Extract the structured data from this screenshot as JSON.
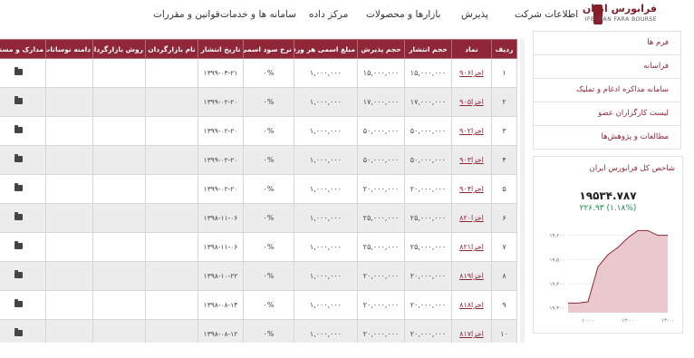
{
  "logo": {
    "name_fa": "فرابورس ایران",
    "name_en": "IFB IRAN FARA BOURSE"
  },
  "nav": {
    "company_info": "اطلاعات شرکت",
    "admission": "پذیرش",
    "markets": "بازارها و محصولات",
    "data_center": "مرکز داده",
    "systems": "سامانه ها و خدمات",
    "laws": "قوانین و مقررات"
  },
  "table": {
    "headers": [
      "ردیف",
      "نماد",
      "حجم انتشار",
      "حجم پذیرش",
      "مبلغ اسمی هر ورقه",
      "نرخ سود اسمی",
      "تاریخ انتشار",
      "نام بازارگردان",
      "روش بازارگردانی",
      "دامنه نوسانات",
      "مدارک و مستندات"
    ],
    "rows": [
      {
        "n": "۱",
        "sym": "اخزا۹۰۶",
        "vol": "۱۵,۰۰۰,۰۰۰",
        "acc": "۱۵,۰۰۰,۰۰۰",
        "nom": "۱,۰۰۰,۰۰۰",
        "rate": "۰%",
        "date": "۱۳۹۹-۰۳-۲۱"
      },
      {
        "n": "۲",
        "sym": "اخزا۹۰۵",
        "vol": "۱۷,۰۰۰,۰۰۰",
        "acc": "۱۷,۰۰۰,۰۰۰",
        "nom": "۱,۰۰۰,۰۰۰",
        "rate": "۰%",
        "date": "۱۳۹۹-۰۲-۲۰"
      },
      {
        "n": "۳",
        "sym": "اخزا۹۰۲",
        "vol": "۵۰,۰۰۰,۰۰۰",
        "acc": "۵۰,۰۰۰,۰۰۰",
        "nom": "۱,۰۰۰,۰۰۰",
        "rate": "۰%",
        "date": "۱۳۹۹-۰۲-۲۰"
      },
      {
        "n": "۴",
        "sym": "اخزا۹۰۳",
        "vol": "۵۰,۰۰۰,۰۰۰",
        "acc": "۵۰,۰۰۰,۰۰۰",
        "nom": "۱,۰۰۰,۰۰۰",
        "rate": "۰%",
        "date": "۱۳۹۹-۰۲-۲۰"
      },
      {
        "n": "۵",
        "sym": "اخزا۹۰۴",
        "vol": "۲۰,۰۰۰,۰۰۰",
        "acc": "۲۰,۰۰۰,۰۰۰",
        "nom": "۱,۰۰۰,۰۰۰",
        "rate": "۰%",
        "date": "۱۳۹۹-۰۲-۲۰"
      },
      {
        "n": "۶",
        "sym": "اخزا۸۲۰",
        "vol": "۲۵,۰۰۰,۰۰۰",
        "acc": "۲۵,۰۰۰,۰۰۰",
        "nom": "۱,۰۰۰,۰۰۰",
        "rate": "۰%",
        "date": "۱۳۹۸-۱۱-۰۶"
      },
      {
        "n": "۷",
        "sym": "اخزا۸۲۱",
        "vol": "۲۵,۰۰۰,۰۰۰",
        "acc": "۲۵,۰۰۰,۰۰۰",
        "nom": "۱,۰۰۰,۰۰۰",
        "rate": "۰%",
        "date": "۱۳۹۸-۱۱-۰۶"
      },
      {
        "n": "۸",
        "sym": "اخزا۸۱۹",
        "vol": "۲۰,۰۰۰,۰۰۰",
        "acc": "۲۰,۰۰۰,۰۰۰",
        "nom": "۱,۰۰۰,۰۰۰",
        "rate": "۰%",
        "date": "۱۳۹۸-۱۰-۲۲"
      },
      {
        "n": "۹",
        "sym": "اخزا۸۱۸",
        "vol": "۲۰,۰۰۰,۰۰۰",
        "acc": "۲۰,۰۰۰,۰۰۰",
        "nom": "۱,۰۰۰,۰۰۰",
        "rate": "۰%",
        "date": "۱۳۹۸-۰۸-۱۴"
      },
      {
        "n": "۱۰",
        "sym": "اخزا۸۱۷",
        "vol": "۲۰,۰۰۰,۰۰۰",
        "acc": "۲۰,۰۰۰,۰۰۰",
        "nom": "۱,۰۰۰,۰۰۰",
        "rate": "۰%",
        "date": "۱۳۹۸-۰۸-۱۲"
      }
    ]
  },
  "sidebar": {
    "items": [
      "فرم ها",
      "فراسانه",
      "سامانه مذاکره ادغام و تملیک",
      "لیست کارگزاران عضو",
      "مطالعات و پژوهش‌ها"
    ]
  },
  "index_widget": {
    "title": "شاخص کل فرابورس ایران",
    "value": "۱۹۵۳۴.۷۸۷",
    "change": "۲۲۶.۹۳ (۱.۱۸%)",
    "change_color": "#1a8f4a"
  },
  "chart_data": {
    "type": "area",
    "x": [
      "09:00",
      "09:30",
      "10:00",
      "10:30",
      "11:00",
      "11:30",
      "12:00",
      "12:30",
      "13:00",
      "13:30",
      "14:00"
    ],
    "series": [
      {
        "values": [
          19320,
          19320,
          19325,
          19470,
          19520,
          19550,
          19590,
          19620,
          19620,
          19600,
          19600
        ]
      }
    ],
    "x_ticks": [
      "۱۰:۰۰",
      "۱۲:۰۰",
      "۱۴:۰۰"
    ],
    "y_ticks": [
      "۱۹,۳۰۰",
      "۱۹,۴۰۰",
      "۱۹,۵۰۰",
      "۱۹,۶۰۰"
    ],
    "ylim": [
      19280,
      19640
    ],
    "color": "#8f2738"
  }
}
